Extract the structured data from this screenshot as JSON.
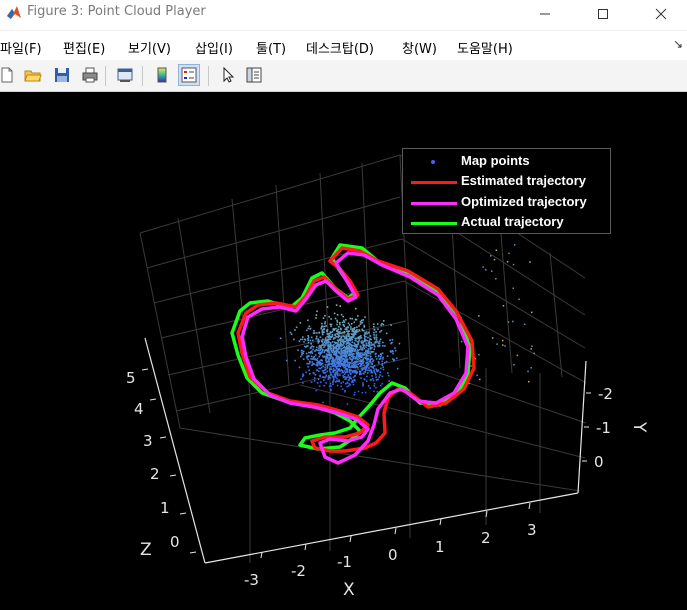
{
  "window": {
    "title": "Figure 3: Point Cloud Player",
    "controls": {
      "minimize": "minimize",
      "maximize": "maximize",
      "close": "close"
    }
  },
  "menu": {
    "items": [
      {
        "label": "파일(F)"
      },
      {
        "label": "편집(E)"
      },
      {
        "label": "보기(V)"
      },
      {
        "label": "삽입(I)"
      },
      {
        "label": "툴(T)"
      },
      {
        "label": "데스크탑(D)"
      },
      {
        "label": "창(W)"
      },
      {
        "label": "도움말(H)"
      }
    ],
    "overflow_icon": "dock-arrow-icon"
  },
  "toolbar": {
    "buttons": [
      {
        "icon": "new-figure-icon"
      },
      {
        "icon": "open-file-icon"
      },
      {
        "icon": "save-icon"
      },
      {
        "icon": "print-icon"
      },
      {
        "icon": "link-plot-icon"
      },
      {
        "icon": "colorbar-icon"
      },
      {
        "icon": "legend-icon",
        "active": true
      },
      {
        "icon": "edit-plot-icon"
      },
      {
        "icon": "property-inspector-icon"
      }
    ]
  },
  "plot": {
    "axis_labels": {
      "x": "X",
      "y": "Y",
      "z": "Z"
    },
    "x_ticks": [
      "-3",
      "-2",
      "-1",
      "0",
      "1",
      "2",
      "3"
    ],
    "y_ticks": [
      "-2",
      "-1",
      "0"
    ],
    "z_ticks": [
      "0",
      "1",
      "2",
      "3",
      "4",
      "5"
    ],
    "legend": [
      {
        "label": "Map points",
        "color": "#4c5cff",
        "kind": "marker"
      },
      {
        "label": "Estimated trajectory",
        "color": "#ff1a1a",
        "kind": "line"
      },
      {
        "label": "Optimized trajectory",
        "color": "#ff2bff",
        "kind": "line"
      },
      {
        "label": "Actual trajectory",
        "color": "#1aff1a",
        "kind": "line"
      }
    ],
    "colors": {
      "background": "#000000",
      "axis": "#e6e6e6",
      "grid": "#3a3a3a"
    }
  }
}
